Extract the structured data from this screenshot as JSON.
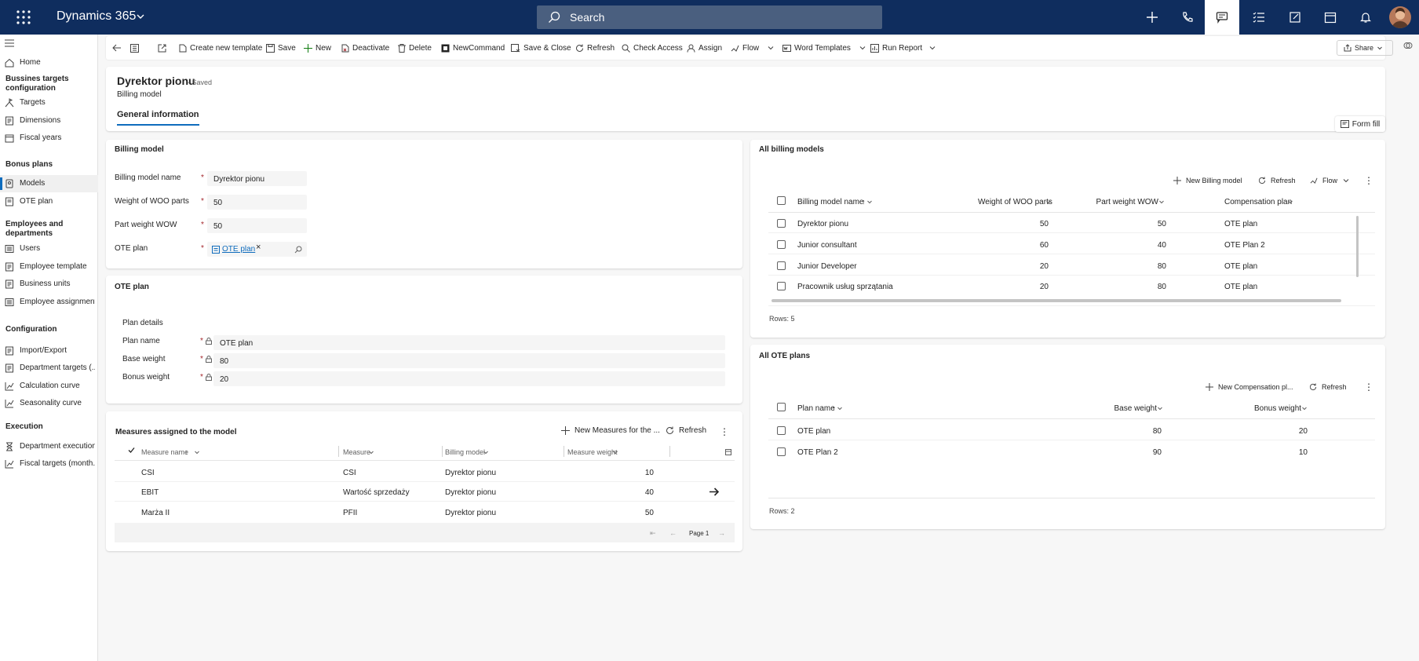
{
  "app": {
    "name": "Dynamics 365"
  },
  "search": {
    "placeholder": "Search"
  },
  "topbar_icons": [
    "plus-icon",
    "phone-icon",
    "chat-icon",
    "task-list-icon",
    "compose-icon",
    "calendar-icon",
    "bell-icon"
  ],
  "nav": {
    "home": "Home",
    "group1": "Bussines targets configuration",
    "targets": "Targets",
    "dimensions": "Dimensions",
    "fiscal_years": "Fiscal years",
    "group2": "Bonus plans",
    "models": "Models",
    "ote_plan": "OTE plan",
    "group3": "Employees and departments",
    "users": "Users",
    "employee_template": "Employee template",
    "business_units": "Business units",
    "employee_assignment": "Employee assignment",
    "group4": "Configuration",
    "import_export": "Import/Export",
    "department_targets": "Department targets (...",
    "calculation_curve": "Calculation curve",
    "seasonality_curve": "Seasonality curve",
    "group5": "Execution",
    "department_execution": "Department execution",
    "fiscal_targets": "Fiscal targets (month..."
  },
  "commands": {
    "create_template": "Create new template",
    "save": "Save",
    "new": "New",
    "deactivate": "Deactivate",
    "delete": "Delete",
    "newcommand": "NewCommand",
    "save_close": "Save & Close",
    "refresh": "Refresh",
    "check_access": "Check Access",
    "assign": "Assign",
    "flow": "Flow",
    "word_templates": "Word Templates",
    "run_report": "Run Report",
    "share": "Share"
  },
  "header": {
    "title": "Dyrektor pionu",
    "saved": "- Saved",
    "subtitle": "Billing model",
    "tab": "General information",
    "form_fill": "Form fill"
  },
  "billing_model": {
    "section": "Billing model",
    "name_label": "Billing model name",
    "name_value": "Dyrektor pionu",
    "woo_label": "Weight of WOO parts",
    "woo_value": "50",
    "wow_label": "Part weight WOW",
    "wow_value": "50",
    "ote_label": "OTE plan",
    "ote_value": "OTE plan",
    "required_mark": "*"
  },
  "ote_section": {
    "section": "OTE plan",
    "details": "Plan details",
    "plan_name_label": "Plan name",
    "plan_name_value": "OTE plan",
    "base_label": "Base weight",
    "base_value": "80",
    "bonus_label": "Bonus weight",
    "bonus_value": "20"
  },
  "measures": {
    "section": "Measures assigned to the model",
    "new_btn": "New Measures for the ...",
    "refresh": "Refresh",
    "headers": [
      "Measure name",
      "Measure",
      "Billing model",
      "Measure weight"
    ],
    "rows": [
      {
        "name": "CSI",
        "measure": "CSI",
        "model": "Dyrektor pionu",
        "weight": "10"
      },
      {
        "name": "EBIT",
        "measure": "Wartość sprzedaży",
        "model": "Dyrektor pionu",
        "weight": "40"
      },
      {
        "name": "Marża II",
        "measure": "PFII",
        "model": "Dyrektor pionu",
        "weight": "50"
      }
    ],
    "page": "Page 1"
  },
  "all_billing": {
    "section": "All billing models",
    "new_btn": "New Billing model",
    "refresh": "Refresh",
    "flow": "Flow",
    "headers": [
      "Billing model name",
      "Weight of WOO parts",
      "Part weight WOW",
      "Compensation plan"
    ],
    "rows": [
      {
        "name": "Dyrektor pionu",
        "woo": "50",
        "wow": "50",
        "plan": "OTE plan"
      },
      {
        "name": "Junior consultant",
        "woo": "60",
        "wow": "40",
        "plan": "OTE Plan 2"
      },
      {
        "name": "Junior Developer",
        "woo": "20",
        "wow": "80",
        "plan": "OTE plan"
      },
      {
        "name": "Pracownik usług sprzątania",
        "woo": "20",
        "wow": "80",
        "plan": "OTE plan"
      }
    ],
    "rows_label": "Rows: 5"
  },
  "all_ote": {
    "section": "All OTE plans",
    "new_btn": "New Compensation pl...",
    "refresh": "Refresh",
    "headers": [
      "Plan name",
      "Base weight",
      "Bonus weight"
    ],
    "rows": [
      {
        "name": "OTE plan",
        "base": "80",
        "bonus": "20"
      },
      {
        "name": "OTE Plan 2",
        "base": "90",
        "bonus": "10"
      }
    ],
    "rows_label": "Rows: 2"
  }
}
